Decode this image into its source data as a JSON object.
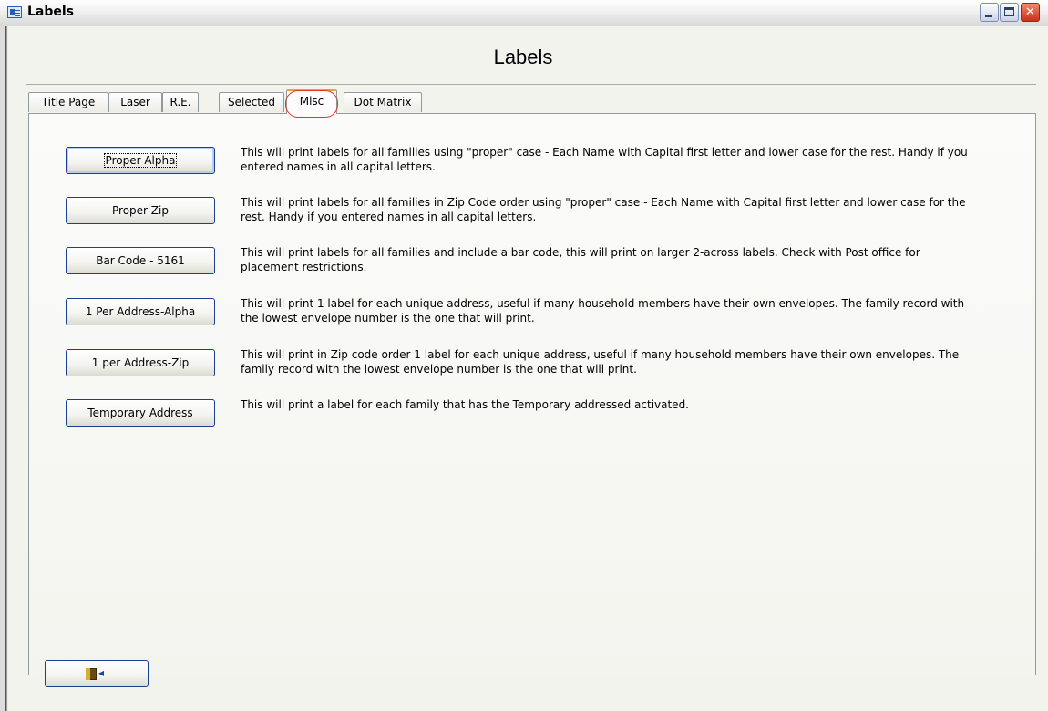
{
  "window": {
    "title": "Labels",
    "controls": [
      "minimize",
      "maximize",
      "close"
    ]
  },
  "form": {
    "heading": "Labels"
  },
  "tabs": [
    {
      "label": "Title Page",
      "active": false
    },
    {
      "label": "Laser",
      "active": false
    },
    {
      "label": "R.E.",
      "active": false
    },
    {
      "label": "Selected",
      "active": false
    },
    {
      "label": "Misc",
      "active": true
    },
    {
      "label": "Dot Matrix",
      "active": false
    }
  ],
  "options": [
    {
      "button": "Proper Alpha",
      "description": "This will print labels for all families using \"proper\" case - Each Name with Capital first letter and lower case for the rest. Handy if you entered names in all capital letters."
    },
    {
      "button": "Proper Zip",
      "description": "This will print labels for all families in Zip Code order using \"proper\" case - Each Name with Capital first letter and lower case for the rest. Handy if you entered names in all capital letters."
    },
    {
      "button": "Bar Code - 5161",
      "description": "This will print labels for all families and include a bar code, this will print on larger 2-across labels.  Check with Post office for placement restrictions."
    },
    {
      "button": "1 Per Address-Alpha",
      "description": "This will print 1 label for each unique address, useful if many household members have their own envelopes. The family record with the lowest envelope number is the one that will print."
    },
    {
      "button": "1 per Address-Zip",
      "description": "This will print in Zip code order 1 label for each unique address, useful if many household members have their own envelopes.  The family record with the lowest envelope number is the one that will print."
    },
    {
      "button": "Temporary Address",
      "description": "This will print a label for each family that has the Temporary addressed activated."
    }
  ],
  "footer": {
    "exit_icon": "exit-door-icon"
  },
  "colors": {
    "active_tab_accent": "#e9a23b",
    "annotation_circle": "#e03a1e",
    "button_border": "#1c3f94"
  }
}
